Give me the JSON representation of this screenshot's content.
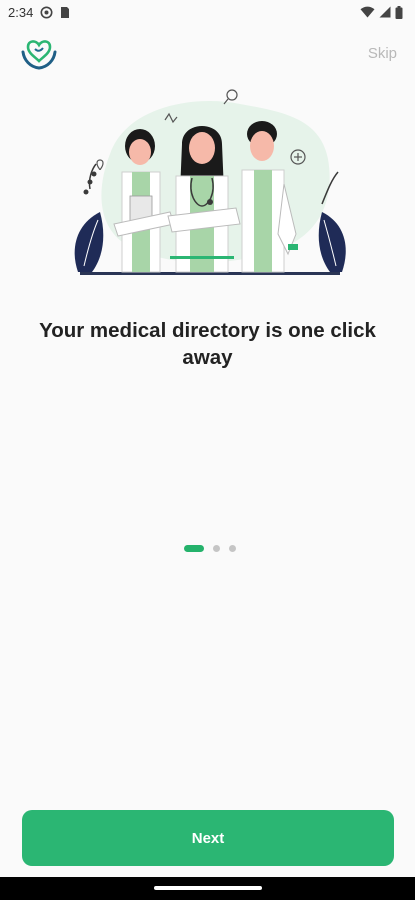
{
  "status_bar": {
    "time": "2:34",
    "icons": [
      "settings-gear-icon",
      "sim-card-icon",
      "wifi-icon",
      "signal-icon",
      "battery-icon"
    ]
  },
  "header": {
    "logo_icon": "heart-hands-logo-icon",
    "skip_label": "Skip"
  },
  "onboarding": {
    "illustration": "doctors-team-illustration",
    "headline": "Your medical directory is one click away",
    "page_indicator": {
      "total": 3,
      "current": 1
    }
  },
  "footer": {
    "next_label": "Next"
  },
  "colors": {
    "accent": "#2bb673",
    "dot_inactive": "#c5c5c5",
    "skip_text": "#b8b8b8",
    "background": "#fafafa"
  }
}
